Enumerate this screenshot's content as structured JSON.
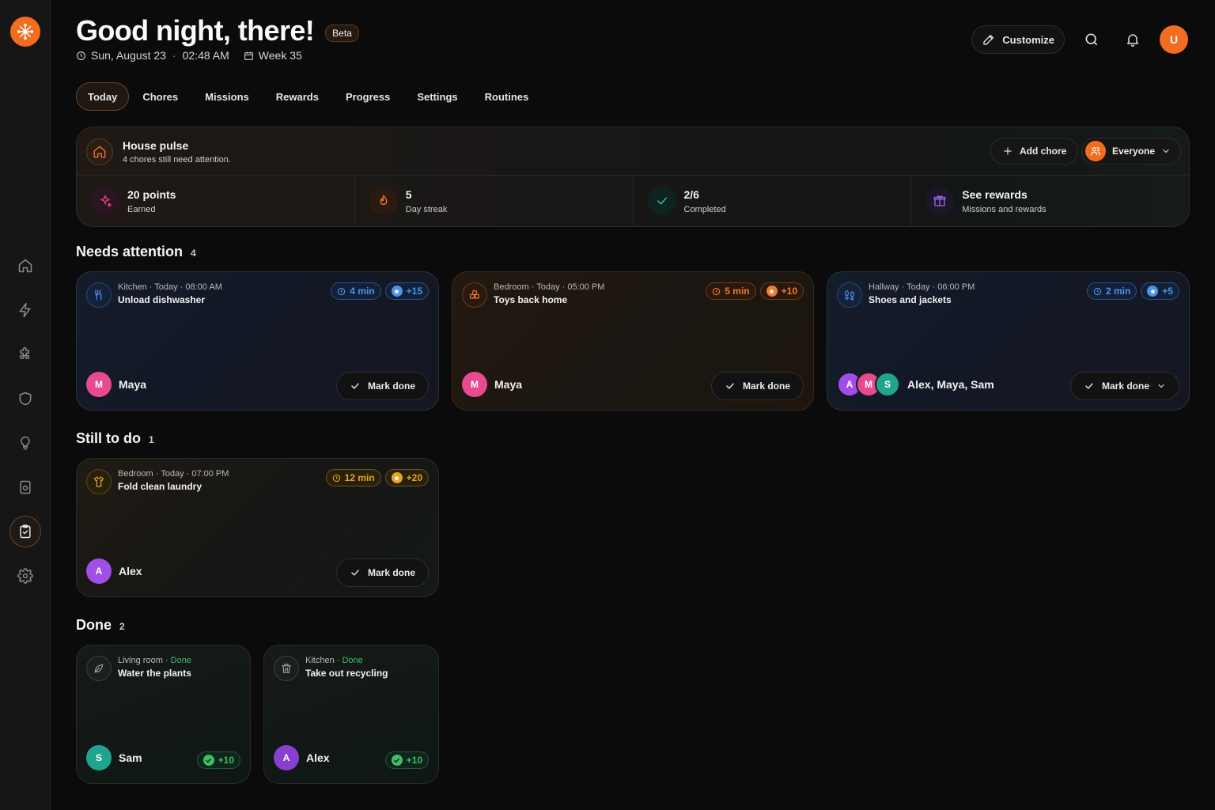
{
  "header": {
    "greeting": "Good night, there!",
    "badge": "Beta",
    "date": "Sun, August 23",
    "time": "02:48 AM",
    "week": "Week 35",
    "customize_label": "Customize",
    "user_initial": "U"
  },
  "tabs": [
    {
      "label": "Today",
      "active": true
    },
    {
      "label": "Chores"
    },
    {
      "label": "Missions"
    },
    {
      "label": "Rewards"
    },
    {
      "label": "Progress"
    },
    {
      "label": "Settings"
    },
    {
      "label": "Routines"
    }
  ],
  "sidebar": {
    "items": [
      "home-icon",
      "bolt-icon",
      "puzzle-icon",
      "shield-icon",
      "lightbulb-icon",
      "device-icon",
      "clipboard-check-icon",
      "settings-icon"
    ],
    "active": "clipboard-check-icon"
  },
  "pulse": {
    "title": "House pulse",
    "subtitle": "4 chores still need attention.",
    "add_chore_label": "Add chore",
    "filter_label": "Everyone",
    "stats": [
      {
        "value": "20 points",
        "label": "Earned",
        "icon": "sparkle-icon",
        "color": "#e0407a"
      },
      {
        "value": "5",
        "label": "Day streak",
        "icon": "flame-icon",
        "color": "#f07a30"
      },
      {
        "value": "2/6",
        "label": "Completed",
        "icon": "check-icon",
        "color": "#2fc1a6"
      },
      {
        "value": "See rewards",
        "label": "Missions and rewards",
        "icon": "gift-icon",
        "color": "#9a68e8"
      }
    ]
  },
  "sections": {
    "needs_attention": {
      "title": "Needs attention",
      "count": "4"
    },
    "still_to_do": {
      "title": "Still to do",
      "count": "1"
    },
    "done": {
      "title": "Done",
      "count": "2"
    }
  },
  "cards": {
    "unload": {
      "meta": "Kitchen · Today · 08:00 AM",
      "title": "Unload dishwasher",
      "time": "4 min",
      "points": "+15",
      "assignee": "Maya",
      "initial": "M",
      "action": "Mark done"
    },
    "toys": {
      "meta": "Bedroom · Today · 05:00 PM",
      "title": "Toys back home",
      "time": "5 min",
      "points": "+10",
      "assignee": "Maya",
      "initial": "M",
      "action": "Mark done"
    },
    "shoes": {
      "meta": "Hallway · Today · 06:00 PM",
      "title": "Shoes and jackets",
      "time": "2 min",
      "points": "+5",
      "assignee": "Alex, Maya, Sam",
      "initials": [
        "A",
        "M",
        "S"
      ],
      "action": "Mark done"
    },
    "laundry": {
      "meta": "Bedroom · Today · 07:00 PM",
      "title": "Fold clean laundry",
      "time": "12 min",
      "points": "+20",
      "assignee": "Alex",
      "initial": "A",
      "action": "Mark done"
    },
    "plants": {
      "room": "Living room · ",
      "status": "Done",
      "title": "Water the plants",
      "points": "+10",
      "assignee": "Sam",
      "initial": "S"
    },
    "recycling": {
      "room": "Kitchen · ",
      "status": "Done",
      "title": "Take out recycling",
      "points": "+10",
      "assignee": "Alex",
      "initial": "A"
    }
  },
  "colors": {
    "accent": "#f26d1f",
    "maya": "#e84a8f",
    "alex": "#a04ee6",
    "sam": "#1fa58f"
  }
}
